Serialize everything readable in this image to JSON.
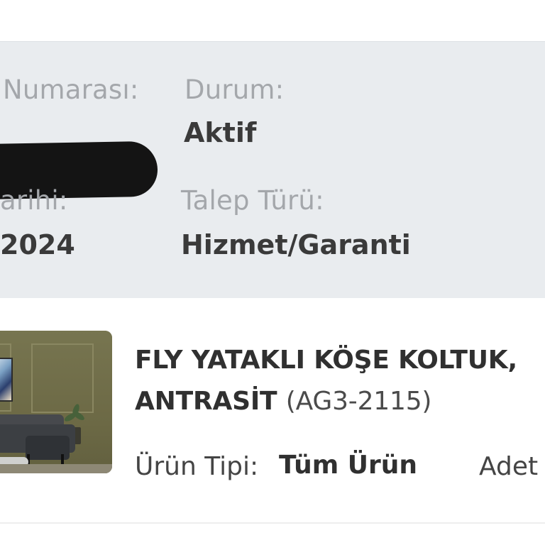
{
  "request_info": {
    "request_number_label": "Numarası:",
    "status_label": "Durum:",
    "status_value": "Aktif",
    "date_label": "arihi:",
    "date_value": "2024",
    "request_type_label": "Talep Türü:",
    "request_type_value": "Hizmet/Garanti"
  },
  "product": {
    "name_line_1": "FLY YATAKLI KÖŞE KOLTUK,",
    "name_line_2": "ANTRASİT",
    "code": "(AG3-2115)",
    "type_label": "Ürün Tipi:",
    "type_value": "Tüm Ürün",
    "quantity_label": "Adet"
  },
  "colors": {
    "panel_background": "#e9ecef",
    "label_text": "#a4a7ab",
    "value_text": "#3a3a3a",
    "redaction": "#141414"
  },
  "icons": {
    "product_image": "sofa-product-image"
  }
}
